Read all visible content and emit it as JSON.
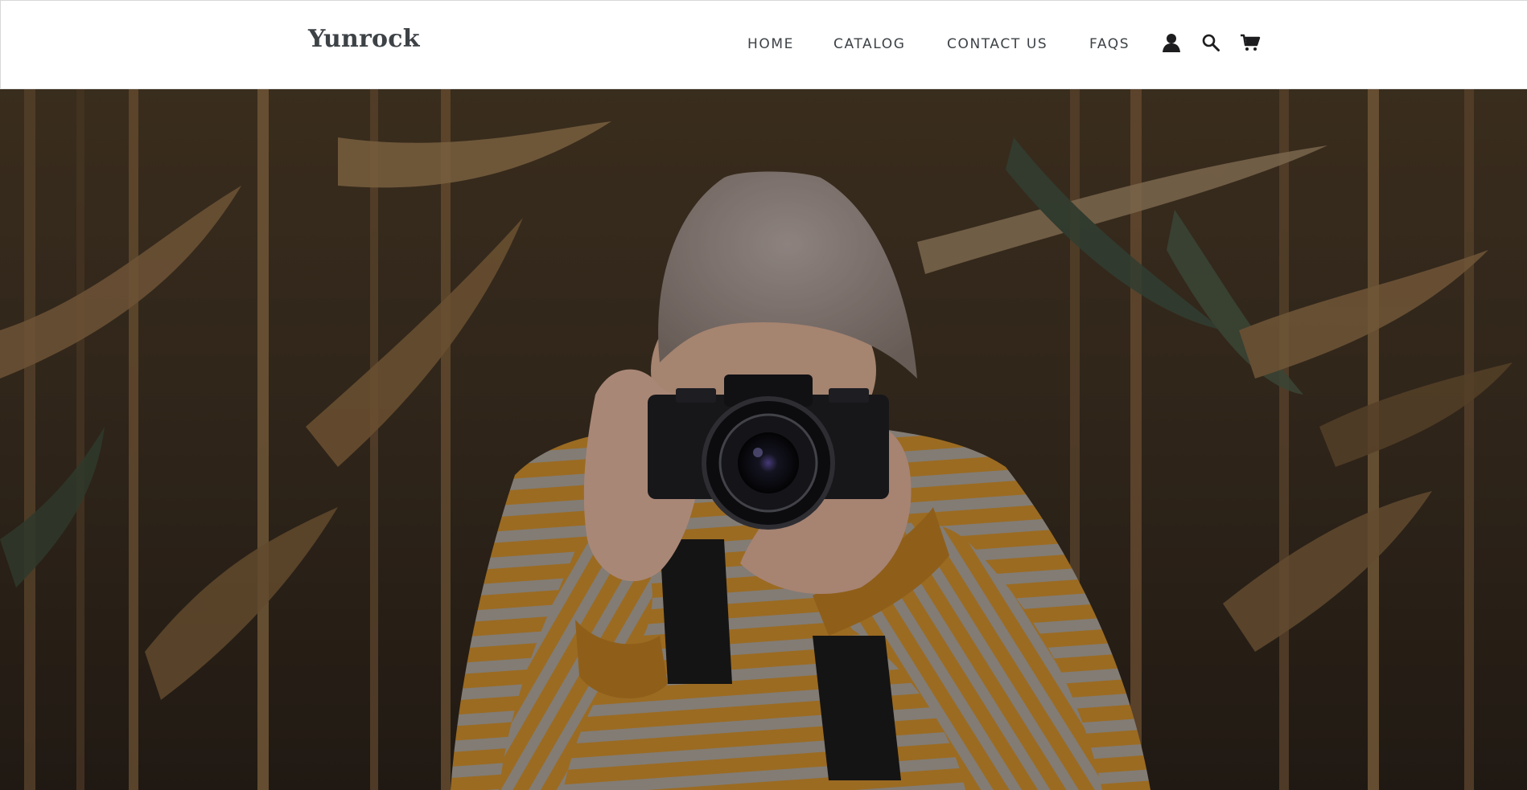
{
  "header": {
    "logo": "Yunrock",
    "nav": [
      {
        "label": "HOME"
      },
      {
        "label": "CATALOG"
      },
      {
        "label": "CONTACT US"
      },
      {
        "label": "FAQS"
      }
    ],
    "icons": [
      "account-icon",
      "search-icon",
      "cart-icon"
    ]
  },
  "hero": {
    "description_colors": {
      "background_dark": "#3a2e20",
      "stalk": "#8a6a44",
      "hat": "#a49591",
      "sweater_mustard": "#c88a2a",
      "sweater_stripe": "#a9a097",
      "camera": "#1e1e22"
    }
  }
}
